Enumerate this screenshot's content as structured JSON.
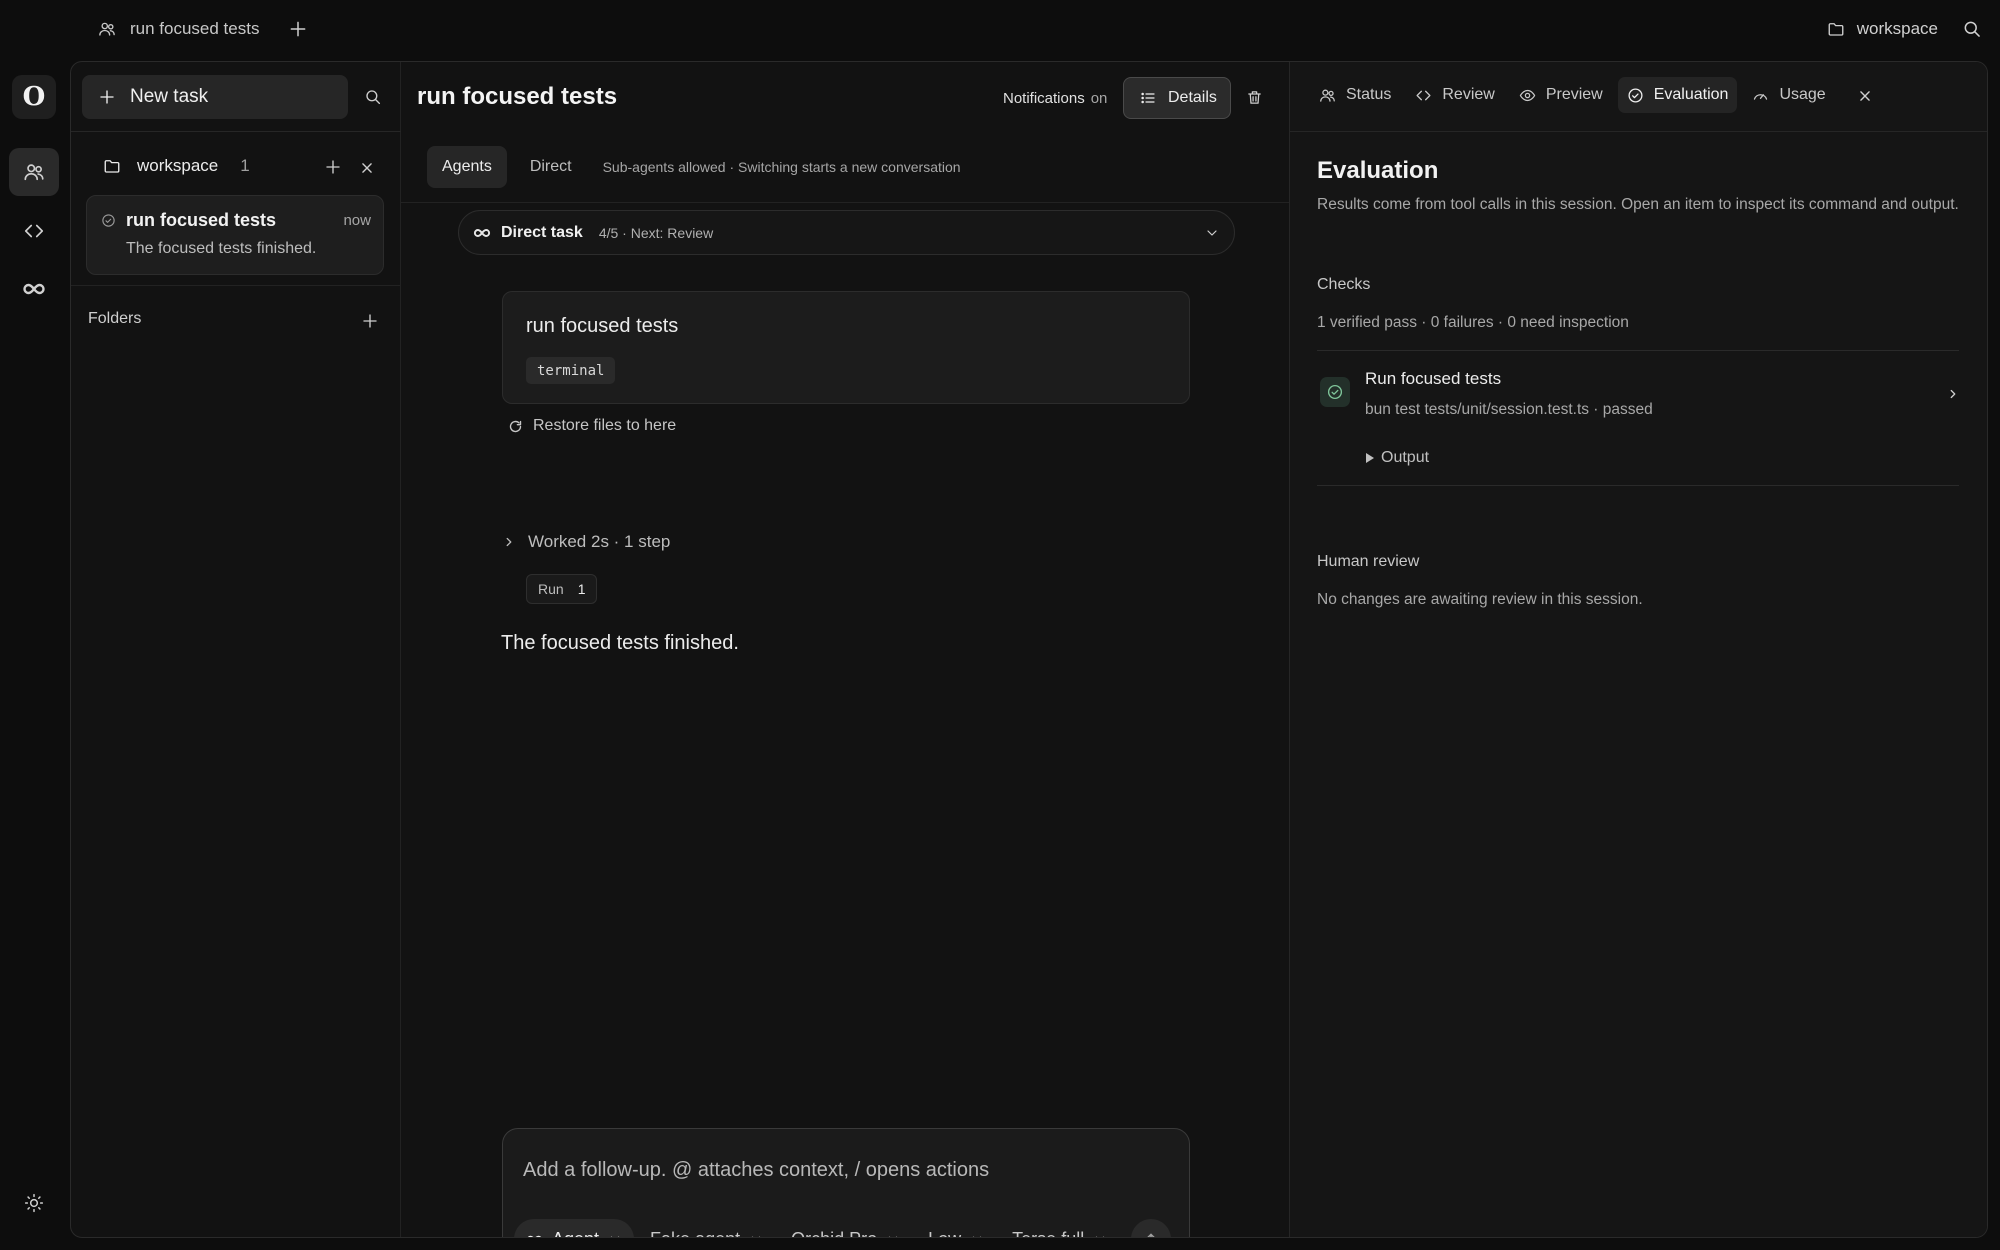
{
  "topbar": {
    "tab_title": "run focused tests",
    "workspace_label": "workspace"
  },
  "rail": {
    "logo_letter": "O"
  },
  "sidebar": {
    "new_task_label": "New task",
    "workspace_name": "workspace",
    "workspace_count": "1",
    "task": {
      "title": "run focused tests",
      "time": "now",
      "summary": "The focused tests finished."
    },
    "folders_label": "Folders"
  },
  "center": {
    "title": "run focused tests",
    "notifications_label": "Notifications",
    "notifications_state": "on",
    "details_label": "Details",
    "modes": [
      {
        "label": "Agents",
        "active": true
      },
      {
        "label": "Direct",
        "active": false
      }
    ],
    "mode_note": "Sub-agents allowed · Switching starts a new conversation",
    "direct_task": {
      "title": "Direct task",
      "progress": "4/5 · Next: Review"
    },
    "user_message": {
      "text": "run focused tests",
      "tag": "terminal"
    },
    "restore_label": "Restore files to here",
    "worked_label": "Worked 2s · 1 step",
    "run_pill": {
      "label": "Run",
      "count": "1"
    },
    "final_message": "The focused tests finished.",
    "composer": {
      "placeholder": "Add a follow-up. @ attaches context, / opens actions",
      "controls": {
        "agent": "Agent",
        "fake_agent": "Fake agent",
        "model": "Orchid Pro",
        "effort": "Low",
        "verbosity": "Terse full"
      }
    }
  },
  "right": {
    "tabs": {
      "status": "Status",
      "review": "Review",
      "preview": "Preview",
      "evaluation": "Evaluation",
      "usage": "Usage"
    },
    "title": "Evaluation",
    "description": "Results come from tool calls in this session. Open an item to inspect its command and output.",
    "checks_heading": "Checks",
    "checks_summary": "1 verified pass · 0 failures · 0 need inspection",
    "check": {
      "name": "Run focused tests",
      "command": "bun test tests/unit/session.test.ts · passed",
      "output_label": "Output"
    },
    "human_review_heading": "Human review",
    "human_review_text": "No changes are awaiting review in this session."
  },
  "colors": {
    "background": "#0d0d0d",
    "panel": "#121212",
    "pass_accent": "#7fc59a"
  }
}
